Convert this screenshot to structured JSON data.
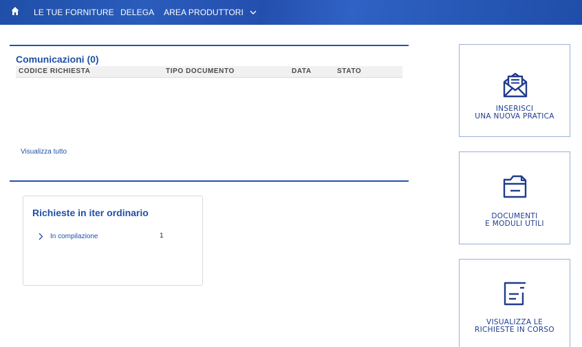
{
  "nav": {
    "home_icon": "home-icon",
    "items": [
      "LE TUE FORNITURE",
      "DELEGA",
      "AREA PRODUTTORI"
    ]
  },
  "communications": {
    "title": "Comunicazioni (0)",
    "columns": [
      "CODICE RICHIESTA",
      "TIPO DOCUMENTO",
      "DATA",
      "STATO"
    ],
    "rows": [],
    "view_all": "Visualizza tutto"
  },
  "requests_card": {
    "title": "Richieste in iter ordinario",
    "items": [
      {
        "label": "In compilazione",
        "count": "1"
      }
    ]
  },
  "tiles": [
    {
      "icon": "envelope-document-icon",
      "line1": "INSERISCI",
      "line2": "UNA NUOVA PRATICA"
    },
    {
      "icon": "folder-document-icon",
      "line1": "DOCUMENTI",
      "line2": "E MODULI UTILI"
    },
    {
      "icon": "list-document-icon",
      "line1": "VISUALIZZA LE",
      "line2": "RICHIESTE IN CORSO"
    }
  ],
  "colors": {
    "nav_bg": "#2452a8",
    "accent": "#1f4fa8",
    "tile_border": "#9bb0d6"
  }
}
